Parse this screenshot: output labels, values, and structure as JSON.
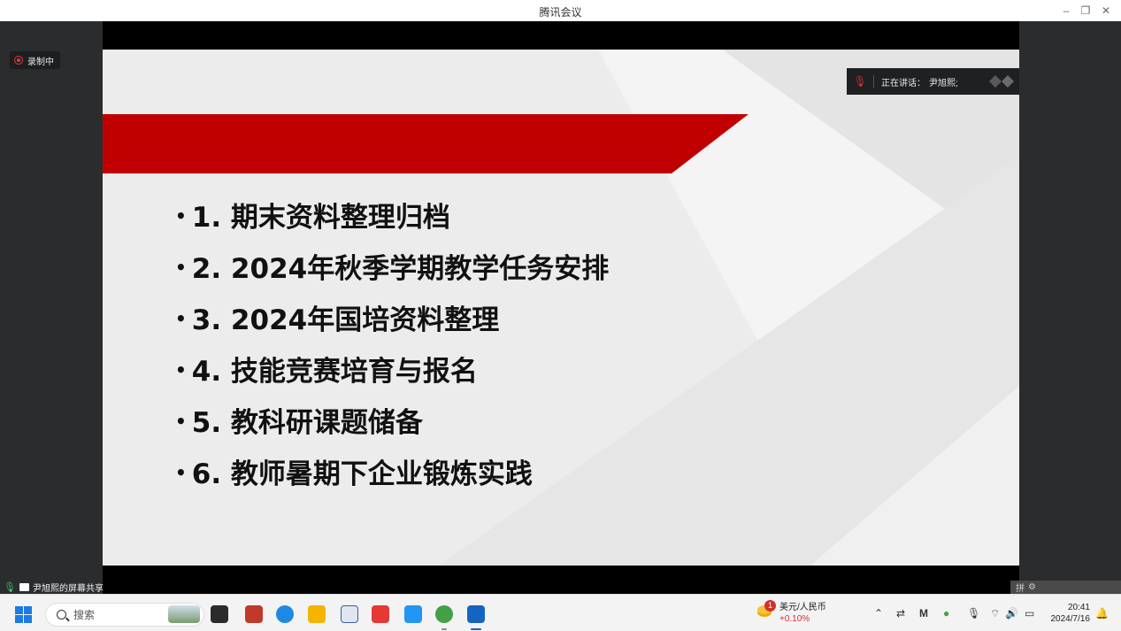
{
  "window": {
    "title": "腾讯会议"
  },
  "meeting": {
    "recording_label": "录制中",
    "speaking_label": "正在讲话：",
    "speaker_name": "尹旭熙;",
    "share_label": "尹旭熙的屏幕共享"
  },
  "slide": {
    "accent_color": "#c00000",
    "bullets": [
      "1. 期末资料整理归档",
      "2. 2024年秋季学期教学任务安排",
      "3. 2024年国培资料整理",
      "4. 技能竞赛培育与报名",
      "5. 教科研课题储备",
      "6. 教师暑期下企业锻炼实践"
    ]
  },
  "ime_bar": {
    "mode": "拼"
  },
  "taskbar": {
    "search_placeholder": "搜索",
    "fx_badge": "1",
    "fx_pair": "美元/人民币",
    "fx_change": "+0.10%",
    "time": "20:41",
    "date": "2024/7/16"
  }
}
